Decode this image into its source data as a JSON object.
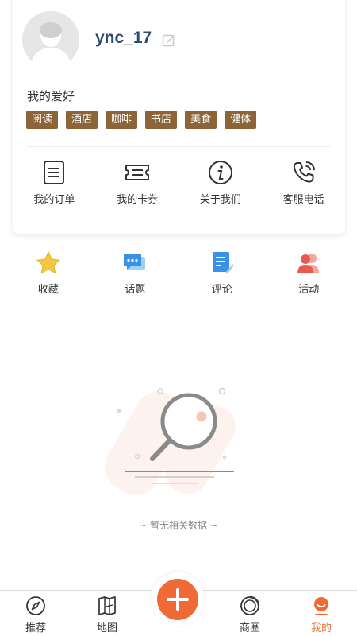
{
  "profile": {
    "username": "ync_17",
    "hobby_title": "我的爱好",
    "tags": [
      "阅读",
      "酒店",
      "咖啡",
      "书店",
      "美食",
      "健体"
    ]
  },
  "quick_links": [
    {
      "label": "我的订单",
      "icon": "order-icon"
    },
    {
      "label": "我的卡券",
      "icon": "coupon-icon"
    },
    {
      "label": "关于我们",
      "icon": "info-icon"
    },
    {
      "label": "客服电话",
      "icon": "phone-icon"
    }
  ],
  "features": [
    {
      "label": "收藏",
      "icon": "star-icon"
    },
    {
      "label": "话题",
      "icon": "chat-icon"
    },
    {
      "label": "评论",
      "icon": "comment-icon"
    },
    {
      "label": "活动",
      "icon": "people-icon"
    }
  ],
  "empty_state": {
    "text": "~ 暂无相关数据 ~"
  },
  "tabbar": {
    "items": [
      {
        "label": "推荐",
        "icon": "compass-icon"
      },
      {
        "label": "地图",
        "icon": "map-icon"
      },
      {
        "label": "商圈",
        "icon": "circle-icon"
      },
      {
        "label": "我的",
        "icon": "smile-icon",
        "active": true
      }
    ],
    "center_icon": "plus-icon"
  },
  "colors": {
    "accent": "#ef6a37",
    "tag_bg": "#8b6538",
    "username": "#2d4a73",
    "active_tab": "#e87a3e"
  }
}
